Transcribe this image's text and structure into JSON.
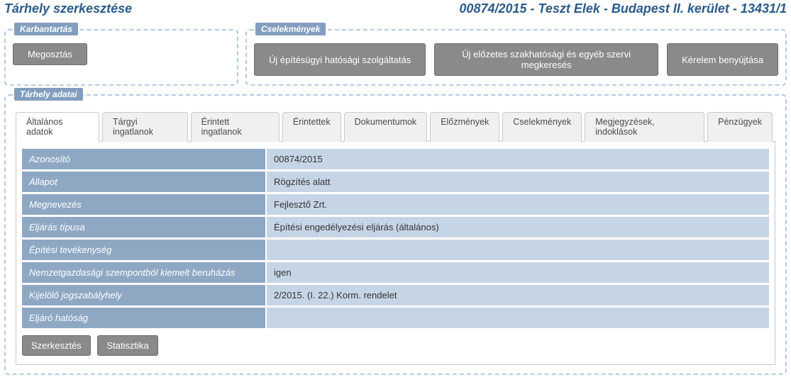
{
  "header": {
    "title": "Tárhely szerkesztése",
    "context": "00874/2015 - Teszt Elek - Budapest II. kerület - 13431/1"
  },
  "maintenance": {
    "legend": "Karbantartás",
    "share_label": "Megosztás"
  },
  "actions": {
    "legend": "Cselekmények",
    "new_service_label": "Új építésügyi hatósági szolgáltatás",
    "new_request_label": "Új előzetes szakhatósági és egyéb szervi megkeresés",
    "submit_label": "Kérelem benyújtása"
  },
  "data_panel": {
    "legend": "Tárhely adatai",
    "tabs": {
      "general": "Általános adatok",
      "properties": "Tárgyi ingatlanok",
      "affected": "Érintett ingatlanok",
      "participants": "Érintettek",
      "documents": "Dokumentumok",
      "history": "Előzmények",
      "acts": "Cselekmények",
      "notes": "Megjegyzések, indoklások",
      "finance": "Pénzügyek"
    },
    "rows": {
      "id": {
        "label": "Azonosító",
        "value": "00874/2015"
      },
      "status": {
        "label": "Állapot",
        "value": "Rögzítés alatt"
      },
      "name": {
        "label": "Megnevezés",
        "value": "Fejlesztő Zrt."
      },
      "proc_type": {
        "label": "Eljárás típusa",
        "value": "Építési engedélyezési eljárás (általános)"
      },
      "activity": {
        "label": "Építési tevékenység",
        "value": ""
      },
      "priority": {
        "label": "Nemzetgazdasági szempontból kiemelt beruházás",
        "value": "igen"
      },
      "regulation": {
        "label": "Kijelölő jogszabályhely",
        "value": "2/2015. (I. 22.) Korm. rendelet"
      },
      "authority": {
        "label": "Eljáró hatóság",
        "value": ""
      }
    },
    "buttons": {
      "edit": "Szerkesztés",
      "stats": "Statisztika"
    }
  }
}
